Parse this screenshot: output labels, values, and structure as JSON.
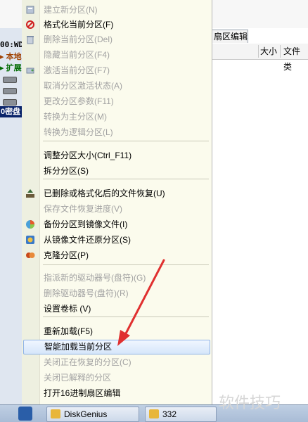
{
  "background": {
    "tab_label": "扇区编辑",
    "columns": [
      "大小",
      "文件类"
    ],
    "tree": [
      "00:WD",
      "本地",
      "扩展",
      "0密盘"
    ]
  },
  "menu": {
    "items": [
      {
        "label": "建立新分区(N)",
        "disabled": true,
        "icon": "new-partition-icon"
      },
      {
        "label": "格式化当前分区(F)",
        "disabled": false,
        "icon": "format-icon"
      },
      {
        "label": "删除当前分区(Del)",
        "disabled": true,
        "icon": "delete-icon"
      },
      {
        "label": "隐藏当前分区(F4)",
        "disabled": true,
        "icon": ""
      },
      {
        "label": "激活当前分区(F7)",
        "disabled": true,
        "icon": "activate-icon"
      },
      {
        "label": "取消分区激活状态(A)",
        "disabled": true,
        "icon": ""
      },
      {
        "label": "更改分区参数(F11)",
        "disabled": true,
        "icon": ""
      },
      {
        "label": "转换为主分区(M)",
        "disabled": true,
        "icon": ""
      },
      {
        "label": "转换为逻辑分区(L)",
        "disabled": true,
        "icon": ""
      },
      {
        "label": "调整分区大小(Ctrl_F11)",
        "disabled": false,
        "icon": ""
      },
      {
        "label": "拆分分区(S)",
        "disabled": false,
        "icon": ""
      },
      {
        "label": "已删除或格式化后的文件恢复(U)",
        "disabled": false,
        "icon": "recover-icon"
      },
      {
        "label": "保存文件恢复进度(V)",
        "disabled": true,
        "icon": ""
      },
      {
        "label": "备份分区到镜像文件(I)",
        "disabled": false,
        "icon": "backup-icon"
      },
      {
        "label": "从镜像文件还原分区(S)",
        "disabled": false,
        "icon": "restore-icon"
      },
      {
        "label": "克隆分区(P)",
        "disabled": false,
        "icon": "clone-icon"
      },
      {
        "label": "指派新的驱动器号(盘符)(G)",
        "disabled": true,
        "icon": ""
      },
      {
        "label": "删除驱动器号(盘符)(R)",
        "disabled": true,
        "icon": ""
      },
      {
        "label": "设置卷标 (V)",
        "disabled": false,
        "icon": ""
      },
      {
        "label": "重新加载(F5)",
        "disabled": false,
        "icon": ""
      },
      {
        "label": "智能加载当前分区",
        "disabled": false,
        "icon": "",
        "highlighted": true
      },
      {
        "label": "关闭正在恢复的分区(C)",
        "disabled": true,
        "icon": ""
      },
      {
        "label": "关闭已解释的分区",
        "disabled": true,
        "icon": ""
      },
      {
        "label": "打开16进制扇区编辑",
        "disabled": false,
        "icon": ""
      }
    ]
  },
  "taskbar": {
    "buttons": [
      "DiskGenius",
      "332"
    ]
  },
  "watermark": "软件技巧",
  "colors": {
    "menu_bg": "#fbfbed",
    "highlight": "#d6e6fa",
    "arrow": "#e03030",
    "disabled_text": "#a2a2a2"
  }
}
